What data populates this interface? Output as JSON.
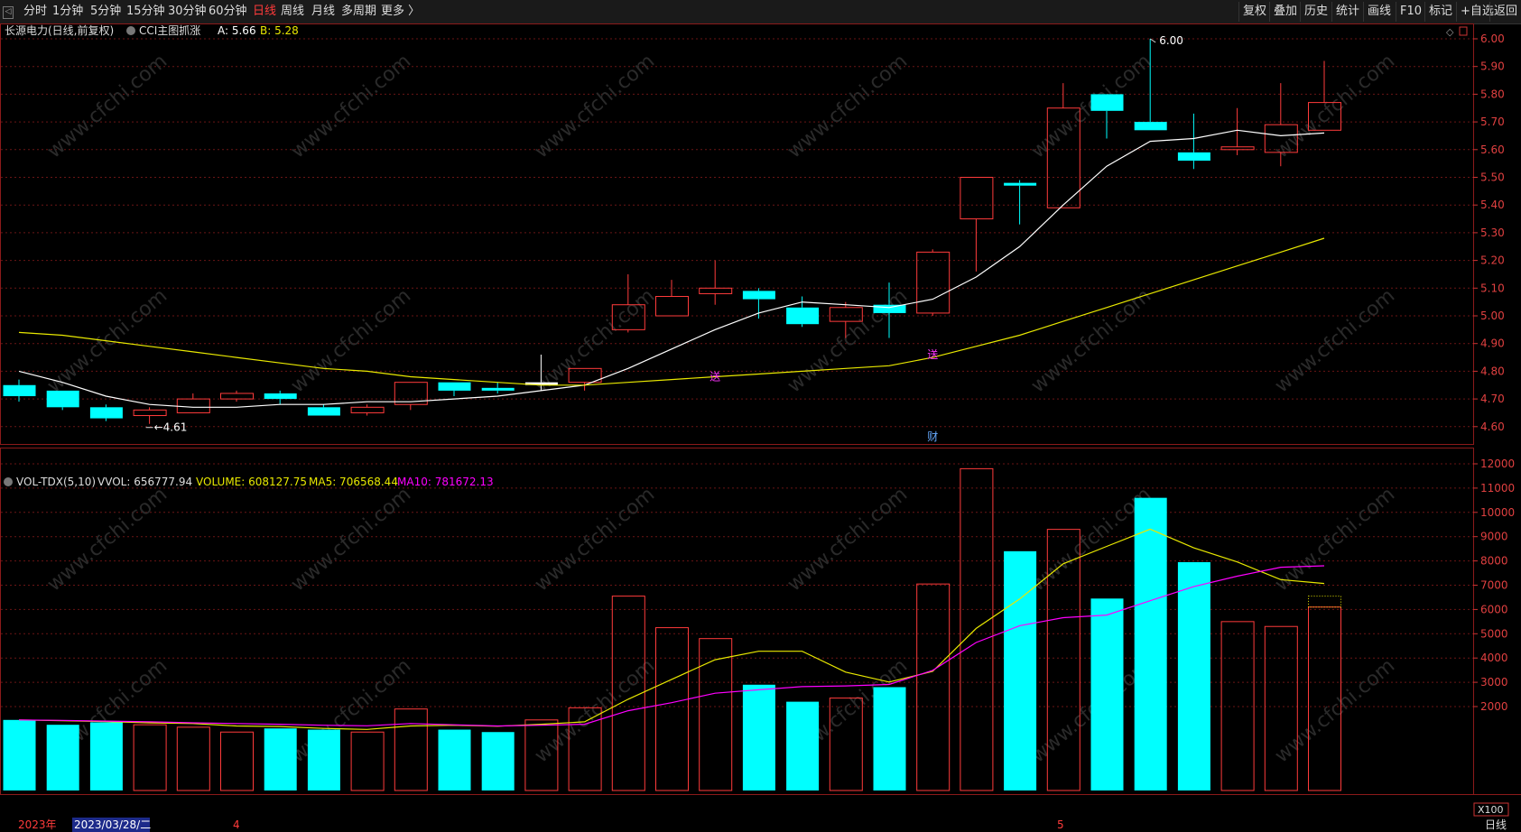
{
  "toolbar": {
    "periods": [
      "分时",
      "1分钟",
      "5分钟",
      "15分钟",
      "30分钟",
      "60分钟",
      "日线",
      "周线",
      "月线",
      "多周期",
      "更多 〉"
    ],
    "active_period": "日线",
    "right_buttons": [
      "复权",
      "叠加",
      "历史",
      "统计",
      "画线",
      "F10",
      "标记",
      "+自选",
      "返回"
    ]
  },
  "main_panel": {
    "stock_title": "长源电力(日线,前复权)",
    "indicator_name": "CCI主图抓涨",
    "indicator_a_label": "A: 5.66",
    "indicator_b_label": "B: 5.28",
    "max_marker": "6.00",
    "min_marker": "4.61",
    "badge_chars": [
      "送",
      "送",
      "财"
    ]
  },
  "volume_panel": {
    "indicator_name": "VOL-TDX(5,10)",
    "vvol": "VVOL: 656777.94",
    "volume": "VOLUME: 608127.75",
    "ma5": "MA5: 706568.44",
    "ma10": "MA10: 781672.13",
    "unit": "X100"
  },
  "xaxis": {
    "year_label": "2023年",
    "cursor_date": "2023/03/28/二",
    "month_labels": [
      "4",
      "5"
    ],
    "period_tab": "日线"
  },
  "colors": {
    "up": "#ff3b3b",
    "down": "#00ffff",
    "ma_short": "#ffffff",
    "ma_long": "#e8e800",
    "vol_ma5": "#e8e800",
    "vol_ma10": "#ff00ff"
  },
  "chart_data": [
    {
      "type": "candlestick",
      "title": "长源电力(日线,前复权)",
      "ylim": [
        4.55,
        6.05
      ],
      "yticks": [
        "6.00",
        "5.90",
        "5.80",
        "5.70",
        "5.60",
        "5.50",
        "5.40",
        "5.30",
        "5.20",
        "5.10",
        "5.00",
        "4.90",
        "4.80",
        "4.70",
        "4.60"
      ],
      "candles": [
        {
          "o": 4.75,
          "h": 4.77,
          "l": 4.69,
          "c": 4.71
        },
        {
          "o": 4.73,
          "h": 4.73,
          "l": 4.66,
          "c": 4.67
        },
        {
          "o": 4.67,
          "h": 4.68,
          "l": 4.62,
          "c": 4.63
        },
        {
          "o": 4.64,
          "h": 4.67,
          "l": 4.61,
          "c": 4.66
        },
        {
          "o": 4.65,
          "h": 4.72,
          "l": 4.65,
          "c": 4.7
        },
        {
          "o": 4.7,
          "h": 4.73,
          "l": 4.69,
          "c": 4.72
        },
        {
          "o": 4.72,
          "h": 4.73,
          "l": 4.68,
          "c": 4.7
        },
        {
          "o": 4.67,
          "h": 4.68,
          "l": 4.64,
          "c": 4.64
        },
        {
          "o": 4.65,
          "h": 4.68,
          "l": 4.64,
          "c": 4.67
        },
        {
          "o": 4.68,
          "h": 4.76,
          "l": 4.66,
          "c": 4.76
        },
        {
          "o": 4.76,
          "h": 4.76,
          "l": 4.71,
          "c": 4.73
        },
        {
          "o": 4.74,
          "h": 4.76,
          "l": 4.72,
          "c": 4.73
        },
        {
          "o": 4.75,
          "h": 4.86,
          "l": 4.73,
          "c": 4.76
        },
        {
          "o": 4.76,
          "h": 4.81,
          "l": 4.73,
          "c": 4.81
        },
        {
          "o": 4.95,
          "h": 5.15,
          "l": 4.94,
          "c": 5.04
        },
        {
          "o": 5.0,
          "h": 5.13,
          "l": 5.0,
          "c": 5.07
        },
        {
          "o": 5.08,
          "h": 5.2,
          "l": 5.04,
          "c": 5.1
        },
        {
          "o": 5.09,
          "h": 5.1,
          "l": 4.99,
          "c": 5.06
        },
        {
          "o": 5.03,
          "h": 5.07,
          "l": 4.96,
          "c": 4.97
        },
        {
          "o": 4.98,
          "h": 5.05,
          "l": 4.92,
          "c": 5.03
        },
        {
          "o": 5.04,
          "h": 5.12,
          "l": 4.92,
          "c": 5.01
        },
        {
          "o": 5.01,
          "h": 5.24,
          "l": 5.0,
          "c": 5.23
        },
        {
          "o": 5.35,
          "h": 5.5,
          "l": 5.16,
          "c": 5.5
        },
        {
          "o": 5.48,
          "h": 5.49,
          "l": 5.33,
          "c": 5.47
        },
        {
          "o": 5.39,
          "h": 5.84,
          "l": 5.39,
          "c": 5.75
        },
        {
          "o": 5.8,
          "h": 5.8,
          "l": 5.64,
          "c": 5.74
        },
        {
          "o": 5.7,
          "h": 6.0,
          "l": 5.67,
          "c": 5.67
        },
        {
          "o": 5.59,
          "h": 5.73,
          "l": 5.53,
          "c": 5.56
        },
        {
          "o": 5.6,
          "h": 5.75,
          "l": 5.58,
          "c": 5.61
        },
        {
          "o": 5.59,
          "h": 5.84,
          "l": 5.54,
          "c": 5.69
        },
        {
          "o": 5.67,
          "h": 5.92,
          "l": 5.67,
          "c": 5.77
        }
      ],
      "ma_short": [
        4.8,
        4.76,
        4.71,
        4.68,
        4.67,
        4.67,
        4.68,
        4.68,
        4.69,
        4.69,
        4.7,
        4.71,
        4.73,
        4.75,
        4.81,
        4.88,
        4.95,
        5.01,
        5.05,
        5.04,
        5.03,
        5.06,
        5.14,
        5.25,
        5.4,
        5.54,
        5.63,
        5.64,
        5.67,
        5.65,
        5.66
      ],
      "ma_long": [
        4.94,
        4.93,
        4.91,
        4.89,
        4.87,
        4.85,
        4.83,
        4.81,
        4.8,
        4.78,
        4.77,
        4.76,
        4.75,
        4.75,
        4.76,
        4.77,
        4.78,
        4.79,
        4.8,
        4.81,
        4.82,
        4.85,
        4.89,
        4.93,
        4.98,
        5.03,
        5.08,
        5.13,
        5.18,
        5.23,
        5.28
      ]
    },
    {
      "type": "bar",
      "title": "VOL-TDX(5,10)",
      "ylim": [
        600,
        12300
      ],
      "yticks": [
        "12000",
        "11000",
        "10000",
        "9000",
        "8000",
        "7000",
        "6000",
        "5000",
        "4000",
        "3000",
        "2000"
      ],
      "values": [
        1450,
        1250,
        1350,
        1250,
        1150,
        950,
        1100,
        1050,
        950,
        1900,
        1050,
        950,
        1450,
        1950,
        6550,
        5250,
        4800,
        2900,
        2200,
        2350,
        2800,
        7050,
        11800,
        8400,
        9300,
        6450,
        10600,
        7950,
        5500,
        5300,
        6100
      ],
      "ma5": [
        1450,
        1420,
        1380,
        1330,
        1300,
        1200,
        1180,
        1100,
        1060,
        1200,
        1230,
        1190,
        1270,
        1370,
        2300,
        3120,
        3930,
        4280,
        4280,
        3420,
        3010,
        3450,
        5220,
        6430,
        7880,
        8600,
        9310,
        8540,
        7960,
        7230,
        7070
      ],
      "ma10": [
        1450,
        1430,
        1400,
        1370,
        1330,
        1300,
        1270,
        1230,
        1210,
        1300,
        1250,
        1200,
        1230,
        1270,
        1830,
        2160,
        2550,
        2690,
        2820,
        2850,
        2910,
        3490,
        4640,
        5330,
        5660,
        5770,
        6360,
        6940,
        7370,
        7740
      ],
      "last_ma10_target": 7800
    }
  ]
}
